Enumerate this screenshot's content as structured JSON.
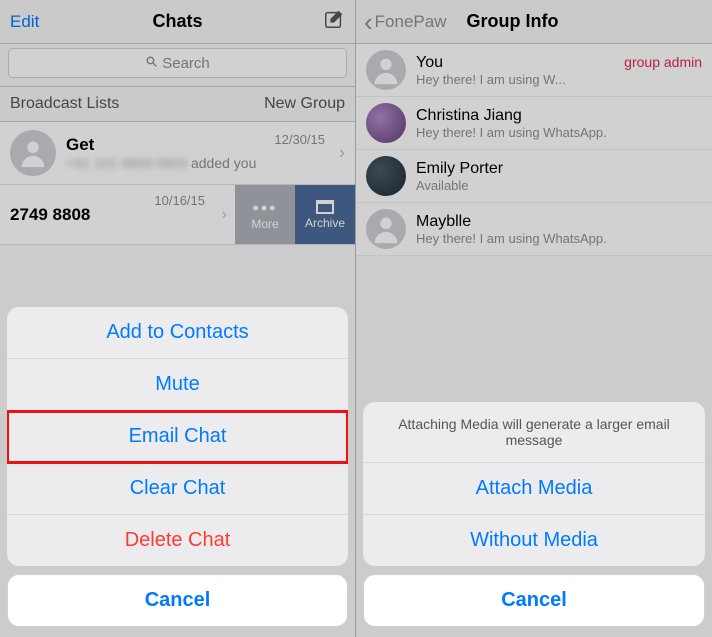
{
  "left": {
    "navbar": {
      "edit": "Edit",
      "title": "Chats"
    },
    "search": {
      "placeholder": "Search"
    },
    "subbar": {
      "broadcast": "Broadcast Lists",
      "newgroup": "New Group"
    },
    "chats": [
      {
        "title": "Get",
        "sub": "added you",
        "time": "12/30/15"
      }
    ],
    "action": {
      "number": "2749 8808",
      "time": "10/16/15",
      "more": "More",
      "archive": "Archive"
    },
    "sheet": {
      "options": [
        {
          "label": "Add to Contacts"
        },
        {
          "label": "Mute"
        },
        {
          "label": "Email Chat",
          "highlight": true
        },
        {
          "label": "Clear Chat"
        },
        {
          "label": "Delete Chat",
          "destructive": true
        }
      ],
      "cancel": "Cancel"
    }
  },
  "right": {
    "navbar": {
      "back": "FonePaw",
      "title": "Group Info"
    },
    "members": [
      {
        "name": "You",
        "status": "Hey there! I am using W...",
        "badge": "group admin",
        "avatar": "blank"
      },
      {
        "name": "Christina Jiang",
        "status": "Hey there! I am using WhatsApp.",
        "avatar": "purple"
      },
      {
        "name": "Emily Porter",
        "status": "Available",
        "avatar": "dark"
      },
      {
        "name": "Mayblle",
        "status": "Hey there! I am using WhatsApp.",
        "avatar": "blank"
      }
    ],
    "sheet": {
      "title": "Attaching Media will generate a larger email message",
      "options": [
        {
          "label": "Attach Media"
        },
        {
          "label": "Without Media"
        }
      ],
      "cancel": "Cancel"
    }
  }
}
